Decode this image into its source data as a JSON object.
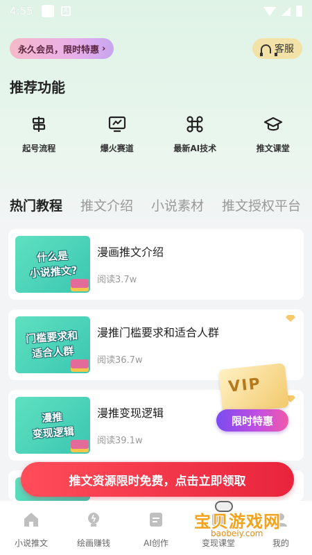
{
  "status_bar": {
    "time": "4:55",
    "notif_letter": "A"
  },
  "header": {
    "vip_label": "永久会员，限时特惠",
    "vip_chevron": "›",
    "service_label": "客服"
  },
  "recommend": {
    "title": "推荐功能",
    "items": [
      {
        "label": "起号流程",
        "icon": "signpost-icon"
      },
      {
        "label": "爆火赛道",
        "icon": "chart-monitor-icon"
      },
      {
        "label": "最新AI技术",
        "icon": "command-icon"
      },
      {
        "label": "推文课堂",
        "icon": "graduation-cap-icon"
      }
    ]
  },
  "tabs": [
    {
      "label": "热门教程",
      "active": true
    },
    {
      "label": "推文介绍",
      "active": false
    },
    {
      "label": "小说素材",
      "active": false
    },
    {
      "label": "推文授权平台",
      "active": false
    }
  ],
  "cards": [
    {
      "thumb_text": "什么是\n小说推文?",
      "title": "漫画推文介绍",
      "reads": "阅读3.7w",
      "premium": false
    },
    {
      "thumb_text": "门槛要求和\n适合人群",
      "title": "漫推门槛要求和适合人群",
      "reads": "阅读36.7w",
      "premium": true
    },
    {
      "thumb_text": "漫推\n变现逻辑",
      "title": "漫推变现逻辑",
      "reads": "阅读39.1w",
      "premium": true
    }
  ],
  "vip_float": {
    "card_text": "VIP",
    "button_label": "限时特惠"
  },
  "promo_banner": {
    "label": "推文资源限时免费，点击立即领取"
  },
  "bottom_nav": [
    {
      "label": "小说推文",
      "icon": "home-icon"
    },
    {
      "label": "绘画赚钱",
      "icon": "bulb-icon"
    },
    {
      "label": "AI创作",
      "icon": "document-icon"
    },
    {
      "label": "变现课堂",
      "icon": "book-icon"
    },
    {
      "label": "我的",
      "icon": "user-icon"
    }
  ],
  "watermark": {
    "text_big": "宝贝游戏网",
    "text_small": "baobeiy.com"
  },
  "colors": {
    "accent_green": "#3bc7b2",
    "promo_red": "#e8243c",
    "vip_purple": "#7b4bf0"
  }
}
